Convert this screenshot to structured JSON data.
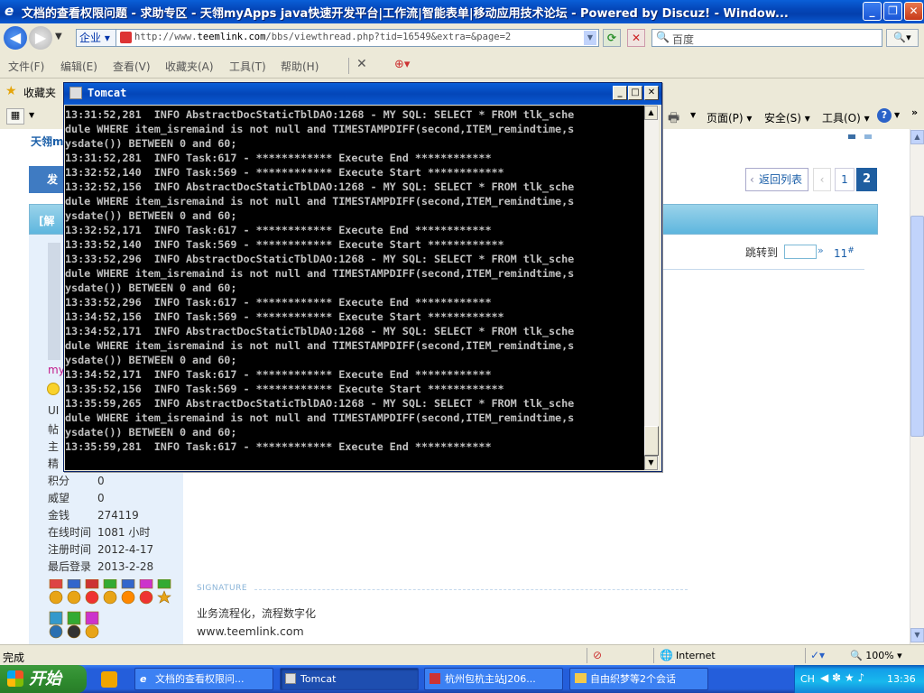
{
  "browser": {
    "title": "文档的查看权限问题 - 求助专区 - 天翎myApps java快速开发平台|工作流|智能表单|移动应用技术论坛 - Powered by Discuz! - Window...",
    "address": {
      "zone": "企业",
      "url_prefix": "http://www.",
      "url_domain": "teemlink.com",
      "url_rest": "/bbs/viewthread.php?tid=16549&extra=&page=2"
    },
    "search_placeholder": "百度",
    "menu": [
      "文件(F)",
      "编辑(E)",
      "查看(V)",
      "收藏夹(A)",
      "工具(T)",
      "帮助(H)"
    ],
    "favorites_label": "收藏夹",
    "commands": {
      "page": "页面(P)",
      "safety": "安全(S)",
      "tools": "工具(O)"
    }
  },
  "forum": {
    "site_link": "天翎m",
    "reply_btn": "发",
    "thread_label": "[解",
    "back_to_list": "返回列表",
    "pages": [
      "1",
      "2"
    ],
    "current_page": "2",
    "jump_label": "跳转到",
    "post_number": "11",
    "post_number_sup": "#",
    "user_name_fragment": "my",
    "user_fields_partial": [
      "UI",
      "帖",
      "主",
      "精"
    ],
    "user_stats": [
      {
        "k": "积分",
        "v": "0"
      },
      {
        "k": "威望",
        "v": "0"
      },
      {
        "k": "金钱",
        "v": "274119"
      },
      {
        "k": "在线时间",
        "v": "1081 小时"
      },
      {
        "k": "注册时间",
        "v": "2012-4-17"
      },
      {
        "k": "最后登录",
        "v": "2013-2-28"
      }
    ],
    "signature_label": "SIGNATURE",
    "signature_line1": "业务流程化，流程数字化",
    "signature_line2": "www.teemlink.com"
  },
  "tomcat": {
    "title": "Tomcat",
    "lines": [
      "13:31:52,281  INFO AbstractDocStaticTblDAO:1268 - MY SQL: SELECT * FROM tlk_sche",
      "dule WHERE item_isremaind is not null and TIMESTAMPDIFF(second,ITEM_remindtime,s",
      "ysdate()) BETWEEN 0 and 60;",
      "13:31:52,281  INFO Task:617 - ************ Execute End ************",
      "13:32:52,140  INFO Task:569 - ************ Execute Start ************",
      "13:32:52,156  INFO AbstractDocStaticTblDAO:1268 - MY SQL: SELECT * FROM tlk_sche",
      "dule WHERE item_isremaind is not null and TIMESTAMPDIFF(second,ITEM_remindtime,s",
      "ysdate()) BETWEEN 0 and 60;",
      "13:32:52,171  INFO Task:617 - ************ Execute End ************",
      "13:33:52,140  INFO Task:569 - ************ Execute Start ************",
      "13:33:52,296  INFO AbstractDocStaticTblDAO:1268 - MY SQL: SELECT * FROM tlk_sche",
      "dule WHERE item_isremaind is not null and TIMESTAMPDIFF(second,ITEM_remindtime,s",
      "ysdate()) BETWEEN 0 and 60;",
      "13:33:52,296  INFO Task:617 - ************ Execute End ************",
      "13:34:52,156  INFO Task:569 - ************ Execute Start ************",
      "13:34:52,171  INFO AbstractDocStaticTblDAO:1268 - MY SQL: SELECT * FROM tlk_sche",
      "dule WHERE item_isremaind is not null and TIMESTAMPDIFF(second,ITEM_remindtime,s",
      "ysdate()) BETWEEN 0 and 60;",
      "13:34:52,171  INFO Task:617 - ************ Execute End ************",
      "13:35:52,156  INFO Task:569 - ************ Execute Start ************",
      "13:35:59,265  INFO AbstractDocStaticTblDAO:1268 - MY SQL: SELECT * FROM tlk_sche",
      "dule WHERE item_isremaind is not null and TIMESTAMPDIFF(second,ITEM_remindtime,s",
      "ysdate()) BETWEEN 0 and 60;",
      "13:35:59,281  INFO Task:617 - ************ Execute End ************"
    ]
  },
  "statusbar": {
    "status": "完成",
    "zone": "Internet",
    "zoom": "100%"
  },
  "taskbar": {
    "start": "开始",
    "tasks": [
      {
        "label": "文档的查看权限问..."
      },
      {
        "label": "Tomcat"
      },
      {
        "label": "杭州包杭主站J206..."
      },
      {
        "label": "自由织梦等2个会话"
      }
    ],
    "lang": "CH",
    "clock": "13:36"
  }
}
